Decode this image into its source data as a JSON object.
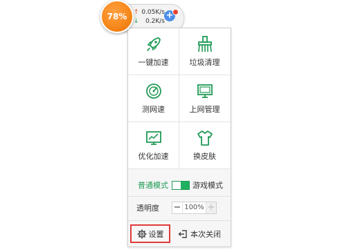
{
  "widget": {
    "percent": "78%",
    "upload_speed": "0.05K/s",
    "download_speed": "0.2K/s",
    "up_arrow": "↑",
    "down_arrow": "↓",
    "plus": "+"
  },
  "menu": {
    "items": [
      {
        "label": "一键加速",
        "icon": "rocket-icon"
      },
      {
        "label": "垃圾清理",
        "icon": "broom-icon"
      },
      {
        "label": "测网速",
        "icon": "speedometer-icon"
      },
      {
        "label": "上网管理",
        "icon": "monitor-icon"
      },
      {
        "label": "优化加速",
        "icon": "chart-icon"
      },
      {
        "label": "换皮肤",
        "icon": "shirt-icon"
      }
    ],
    "mode": {
      "normal_label": "普通模式",
      "game_label": "游戏模式"
    },
    "opacity": {
      "label": "透明度",
      "minus": "−",
      "value": "100%",
      "plus": "+"
    },
    "settings_label": "设置",
    "close_label": "本次关闭"
  },
  "colors": {
    "accent_green": "#1f9a55",
    "ball_orange": "#f7891c",
    "highlight_red": "#e03a3a"
  }
}
